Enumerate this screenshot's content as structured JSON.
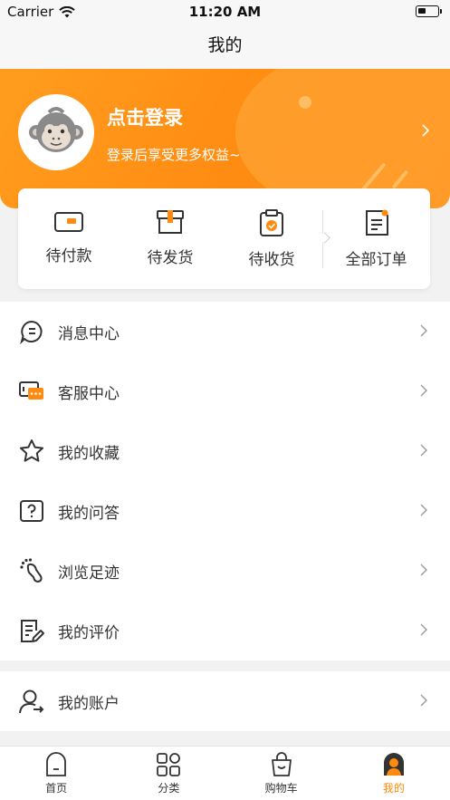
{
  "status_bar": {
    "carrier": "Carrier",
    "time": "11:20 AM"
  },
  "nav": {
    "title": "我的"
  },
  "profile": {
    "login_title": "点击登录",
    "login_subtitle": "登录后享受更多权益~"
  },
  "orders": {
    "items": [
      {
        "label": "待付款",
        "icon": "wallet-icon"
      },
      {
        "label": "待发货",
        "icon": "box-icon"
      },
      {
        "label": "待收货",
        "icon": "clipboard-check-icon"
      },
      {
        "label": "全部订单",
        "icon": "document-icon"
      }
    ]
  },
  "menu_group_1": [
    {
      "label": "消息中心",
      "icon": "message-icon"
    },
    {
      "label": "客服中心",
      "icon": "customer-service-icon"
    },
    {
      "label": "我的收藏",
      "icon": "star-icon"
    },
    {
      "label": "我的问答",
      "icon": "question-icon"
    },
    {
      "label": "浏览足迹",
      "icon": "footprint-icon"
    },
    {
      "label": "我的评价",
      "icon": "review-icon"
    }
  ],
  "menu_group_2": [
    {
      "label": "我的账户",
      "icon": "account-icon"
    }
  ],
  "tabbar": {
    "tabs": [
      {
        "label": "首页",
        "icon": "home-icon"
      },
      {
        "label": "分类",
        "icon": "category-icon"
      },
      {
        "label": "购物车",
        "icon": "cart-icon"
      },
      {
        "label": "我的",
        "icon": "profile-icon",
        "active": true
      }
    ]
  },
  "colors": {
    "accent": "#ff8a10",
    "hero_start": "#ff9d1f"
  }
}
